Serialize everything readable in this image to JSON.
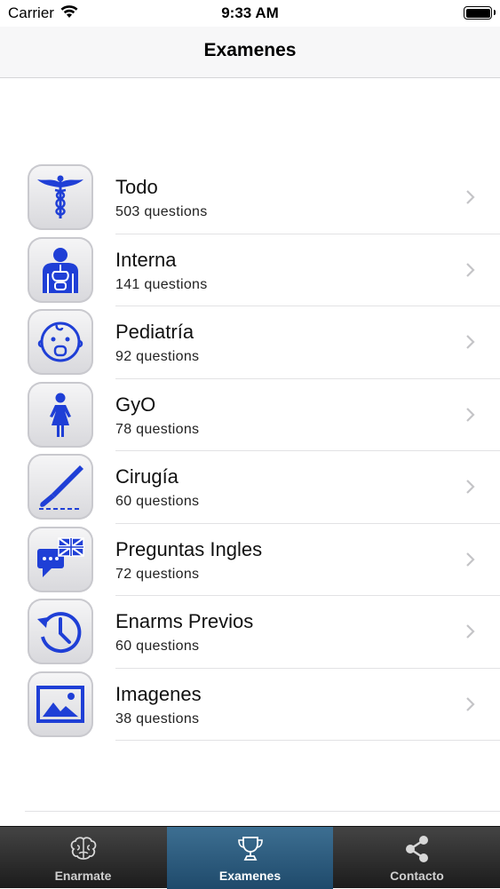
{
  "status_bar": {
    "carrier": "Carrier",
    "time": "9:33 AM"
  },
  "navbar": {
    "title": "Examenes"
  },
  "items": [
    {
      "label": "Todo",
      "count": "503 questions",
      "icon": "caduceus-icon"
    },
    {
      "label": "Interna",
      "count": "141 questions",
      "icon": "torso-organs-icon"
    },
    {
      "label": "Pediatría",
      "count": "92 questions",
      "icon": "baby-face-icon"
    },
    {
      "label": "GyO",
      "count": "78 questions",
      "icon": "woman-icon"
    },
    {
      "label": "Cirugía",
      "count": "60 questions",
      "icon": "scalpel-icon"
    },
    {
      "label": "Preguntas Ingles",
      "count": "72 questions",
      "icon": "speech-flag-icon"
    },
    {
      "label": "Enarms Previos",
      "count": "60 questions",
      "icon": "history-clock-icon"
    },
    {
      "label": "Imagenes",
      "count": "38 questions",
      "icon": "image-icon"
    }
  ],
  "tabbar": {
    "tabs": [
      {
        "label": "Enarmate",
        "icon": "brain-icon"
      },
      {
        "label": "Examenes",
        "icon": "trophy-icon"
      },
      {
        "label": "Contacto",
        "icon": "share-icon"
      }
    ],
    "active_index": 1
  },
  "colors": {
    "icon_blue": "#1f3fd6",
    "active_tab": "#2b5a7e"
  }
}
